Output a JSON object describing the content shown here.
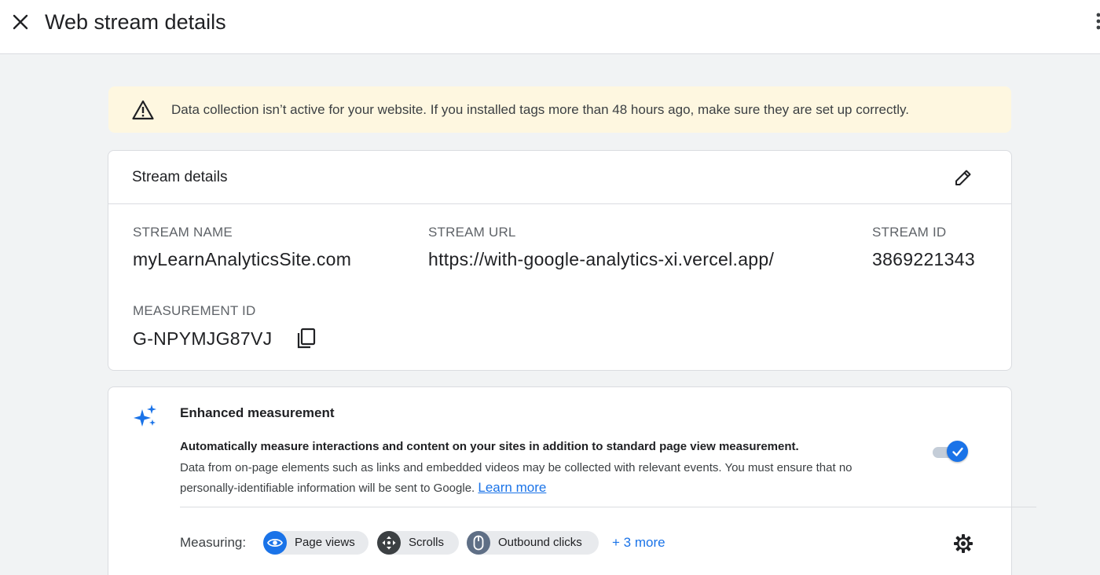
{
  "header": {
    "title": "Web stream details",
    "close_icon": "close-icon",
    "more_icon": "more-vert-icon"
  },
  "alert": {
    "icon": "warning-icon",
    "text": "Data collection isn’t active for your website. If you installed tags more than 48 hours ago, make sure they are set up correctly.",
    "background": "#fef7e0"
  },
  "stream_details": {
    "title": "Stream details",
    "edit_icon": "edit-icon",
    "fields": {
      "stream_name": {
        "label": "STREAM NAME",
        "value": "myLearnAnalyticsSite.com"
      },
      "stream_url": {
        "label": "STREAM URL",
        "value": "https://with-google-analytics-xi.vercel.app/"
      },
      "stream_id": {
        "label": "STREAM ID",
        "value": "3869221343"
      },
      "measurement_id": {
        "label": "MEASUREMENT ID",
        "value": "G-NPYMJG87VJ"
      }
    },
    "copy_icon": "copy-icon"
  },
  "enhanced_measurement": {
    "icon": "sparkle-icon",
    "title": "Enhanced measurement",
    "description_bold": "Automatically measure interactions and content on your sites in addition to standard page view measurement.",
    "description": "Data from on-page elements such as links and embedded videos may be collected with relevant events. You must ensure that no personally-identifiable information will be sent to Google.",
    "learn_more": "Learn more",
    "toggle_on": true,
    "measuring_label": "Measuring:",
    "chips": [
      {
        "label": "Page views",
        "icon": "eye-icon",
        "color": "#1a73e8"
      },
      {
        "label": "Scrolls",
        "icon": "scroll-arrows-icon",
        "color": "#3c4043"
      },
      {
        "label": "Outbound clicks",
        "icon": "mouse-icon",
        "color": "#5f6f86"
      }
    ],
    "more_link": "+ 3 more",
    "settings_icon": "gear-icon"
  },
  "colors": {
    "accent": "#1a73e8",
    "background": "#f1f3f4",
    "card": "#ffffff",
    "border": "#dadce0"
  }
}
